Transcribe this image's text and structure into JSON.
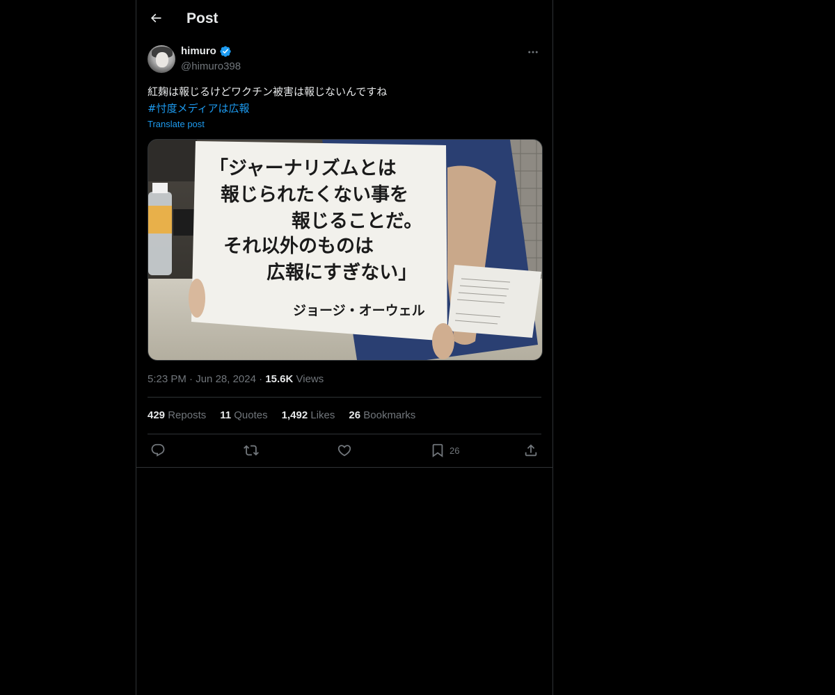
{
  "header": {
    "title": "Post"
  },
  "author": {
    "display_name": "himuro",
    "handle": "@himuro398",
    "verified": true
  },
  "post": {
    "text": "紅麹は報じるけどワクチン被害は報じないんですね",
    "hashtag": "#忖度メディアは広報",
    "translate_label": "Translate post"
  },
  "media": {
    "sign_lines": [
      "「ジャーナリズムとは",
      "報じられたくない事を",
      "報じることだ。",
      "それ以外のものは",
      "広報にすぎない」"
    ],
    "sign_attribution": "ジョージ・オーウェル"
  },
  "meta": {
    "time": "5:23 PM",
    "date": "Jun 28, 2024",
    "views_count": "15.6K",
    "views_label": "Views"
  },
  "stats": {
    "reposts_count": "429",
    "reposts_label": "Reposts",
    "quotes_count": "11",
    "quotes_label": "Quotes",
    "likes_count": "1,492",
    "likes_label": "Likes",
    "bookmarks_count": "26",
    "bookmarks_label": "Bookmarks"
  },
  "actions": {
    "bookmark_count": "26"
  },
  "colors": {
    "background": "#000000",
    "text_primary": "#e7e9ea",
    "text_secondary": "#71767b",
    "accent": "#1d9bf0",
    "border": "#2f3336"
  },
  "icons": {
    "back": "arrow-left-icon",
    "verified": "verified-badge-icon",
    "more": "more-horizontal-icon",
    "reply": "reply-icon",
    "repost": "repost-icon",
    "like": "heart-icon",
    "bookmark": "bookmark-icon",
    "share": "share-icon"
  }
}
